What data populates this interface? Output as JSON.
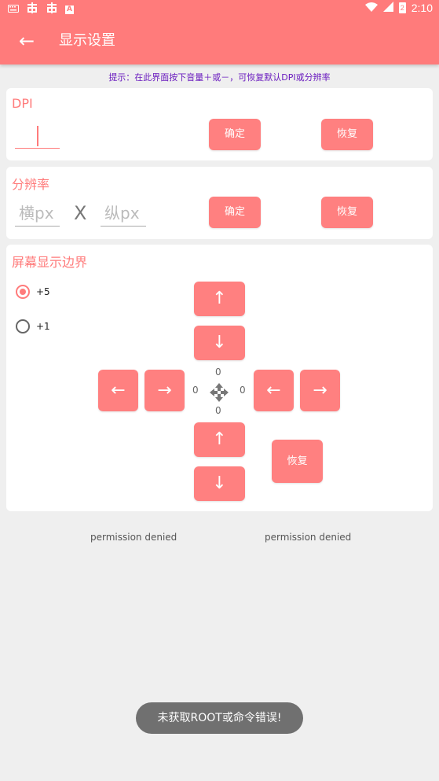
{
  "status_bar": {
    "time": "2:10",
    "left_badge": "A",
    "battery": "2"
  },
  "header": {
    "back_icon": "←",
    "title": "显示设置"
  },
  "hint": "提示：在此界面按下音量＋或－，可恢复默认DPI或分辨率",
  "dpi": {
    "title": "DPI",
    "value": "",
    "confirm": "确定",
    "reset": "恢复"
  },
  "resolution": {
    "title": "分辨率",
    "width_placeholder": "横px",
    "separator": "X",
    "height_placeholder": "纵px",
    "confirm": "确定",
    "reset": "恢复"
  },
  "boundary": {
    "title": "屏幕显示边界",
    "options": [
      {
        "label": "+5",
        "checked": true
      },
      {
        "label": "+1",
        "checked": false
      }
    ],
    "arrows": {
      "up": "↑",
      "down": "↓",
      "left": "←",
      "right": "→"
    },
    "values": {
      "top": "0",
      "left": "0",
      "right": "0",
      "bottom": "0"
    },
    "reset": "恢复"
  },
  "permissions": {
    "left": "permission denied",
    "right": "permission denied"
  },
  "toast": "未获取ROOT或命令错误!"
}
